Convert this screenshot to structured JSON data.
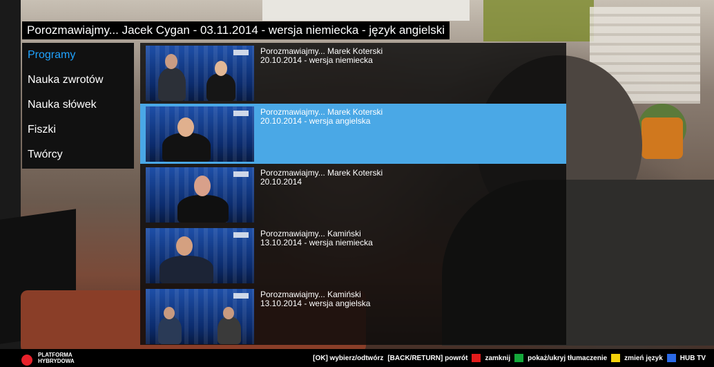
{
  "header": {
    "title": "Porozmawiajmy... Jacek Cygan - 03.11.2014 - wersja niemiecka - język angielski"
  },
  "sidebar": {
    "items": [
      {
        "label": "Programy",
        "active": true
      },
      {
        "label": "Nauka zwrotów",
        "active": false
      },
      {
        "label": "Nauka słówek",
        "active": false
      },
      {
        "label": "Fiszki",
        "active": false
      },
      {
        "label": "Twórcy",
        "active": false
      }
    ]
  },
  "programs": [
    {
      "title": "Porozmawiajmy... Marek Koterski",
      "subtitle": "20.10.2014 - wersja niemiecka",
      "selected": false
    },
    {
      "title": "Porozmawiajmy... Marek Koterski",
      "subtitle": "20.10.2014 - wersja angielska",
      "selected": true
    },
    {
      "title": "Porozmawiajmy... Marek Koterski",
      "subtitle": "20.10.2014",
      "selected": false
    },
    {
      "title": "Porozmawiajmy... Kamiński",
      "subtitle": "13.10.2014 - wersja niemiecka",
      "selected": false
    },
    {
      "title": "Porozmawiajmy... Kamiński",
      "subtitle": "13.10.2014 - wersja angielska",
      "selected": false
    }
  ],
  "footer": {
    "brand_line1": "PLATFORMA",
    "brand_line2": "HYBRYDOWA",
    "hint_ok": "[OK] wybierz/odtwórz",
    "hint_back": "[BACK/RETURN] powrót",
    "hint_red": "zamknij",
    "hint_green": "pokaż/ukryj tłumaczenie",
    "hint_yellow": "zmień język",
    "hint_blue": "HUB TV"
  },
  "colors": {
    "accent": "#1fa3ff",
    "selected_row": "#4aa8e6",
    "key_red": "#e31b1b",
    "key_green": "#14a83a",
    "key_yellow": "#f4d20a",
    "key_blue": "#2b6ae8"
  }
}
